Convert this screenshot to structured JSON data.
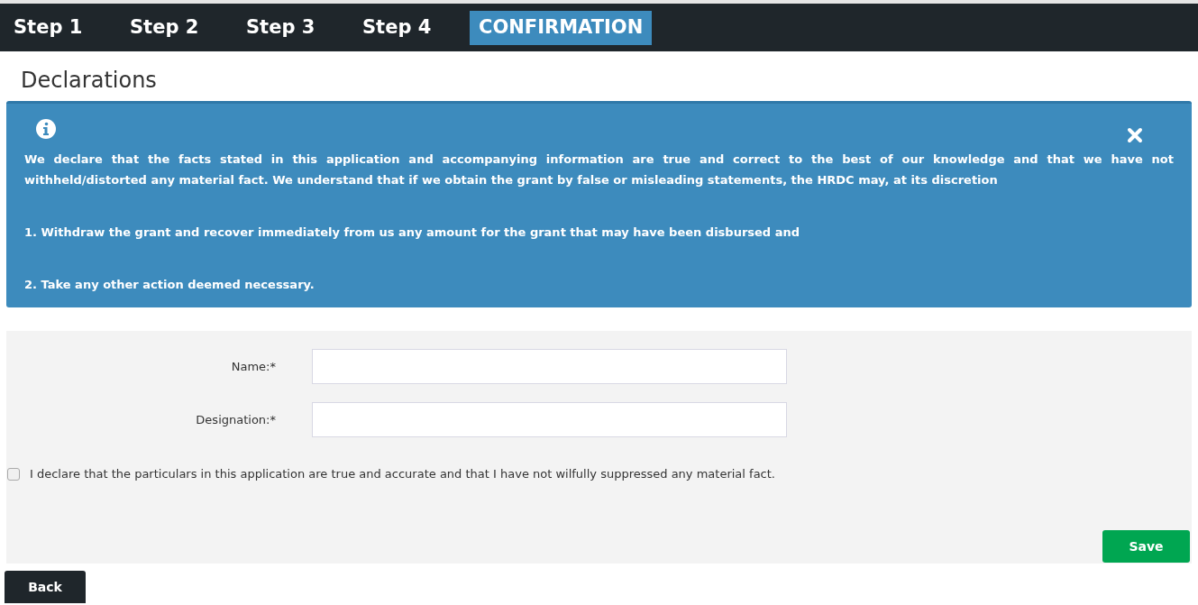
{
  "steps": [
    {
      "label": "Step 1",
      "selected": false
    },
    {
      "label": "Step 2",
      "selected": false
    },
    {
      "label": "Step 3",
      "selected": false
    },
    {
      "label": "Step 4",
      "selected": false
    },
    {
      "label": "CONFIRMATION",
      "selected": true
    }
  ],
  "heading": "Declarations",
  "alert": {
    "paragraphs": [
      "We declare that the facts stated in this application and accompanying information are true and correct to the best of our knowledge and that we have not withheld/distorted any material fact. We understand that if we obtain the grant by false or misleading statements, the HRDC may, at its discretion",
      "1. Withdraw the grant and recover immediately from us any amount for the grant that may have been disbursed and",
      "2. Take any other action deemed necessary."
    ]
  },
  "form": {
    "fields": [
      {
        "label": "Name:*"
      },
      {
        "label": "Designation:*"
      }
    ],
    "declaration": {
      "label": "I declare that the particulars in this application are true and accurate and that I have not wilfully suppressed any material fact.",
      "checked": false
    },
    "save": "Save"
  },
  "back": "Back"
}
